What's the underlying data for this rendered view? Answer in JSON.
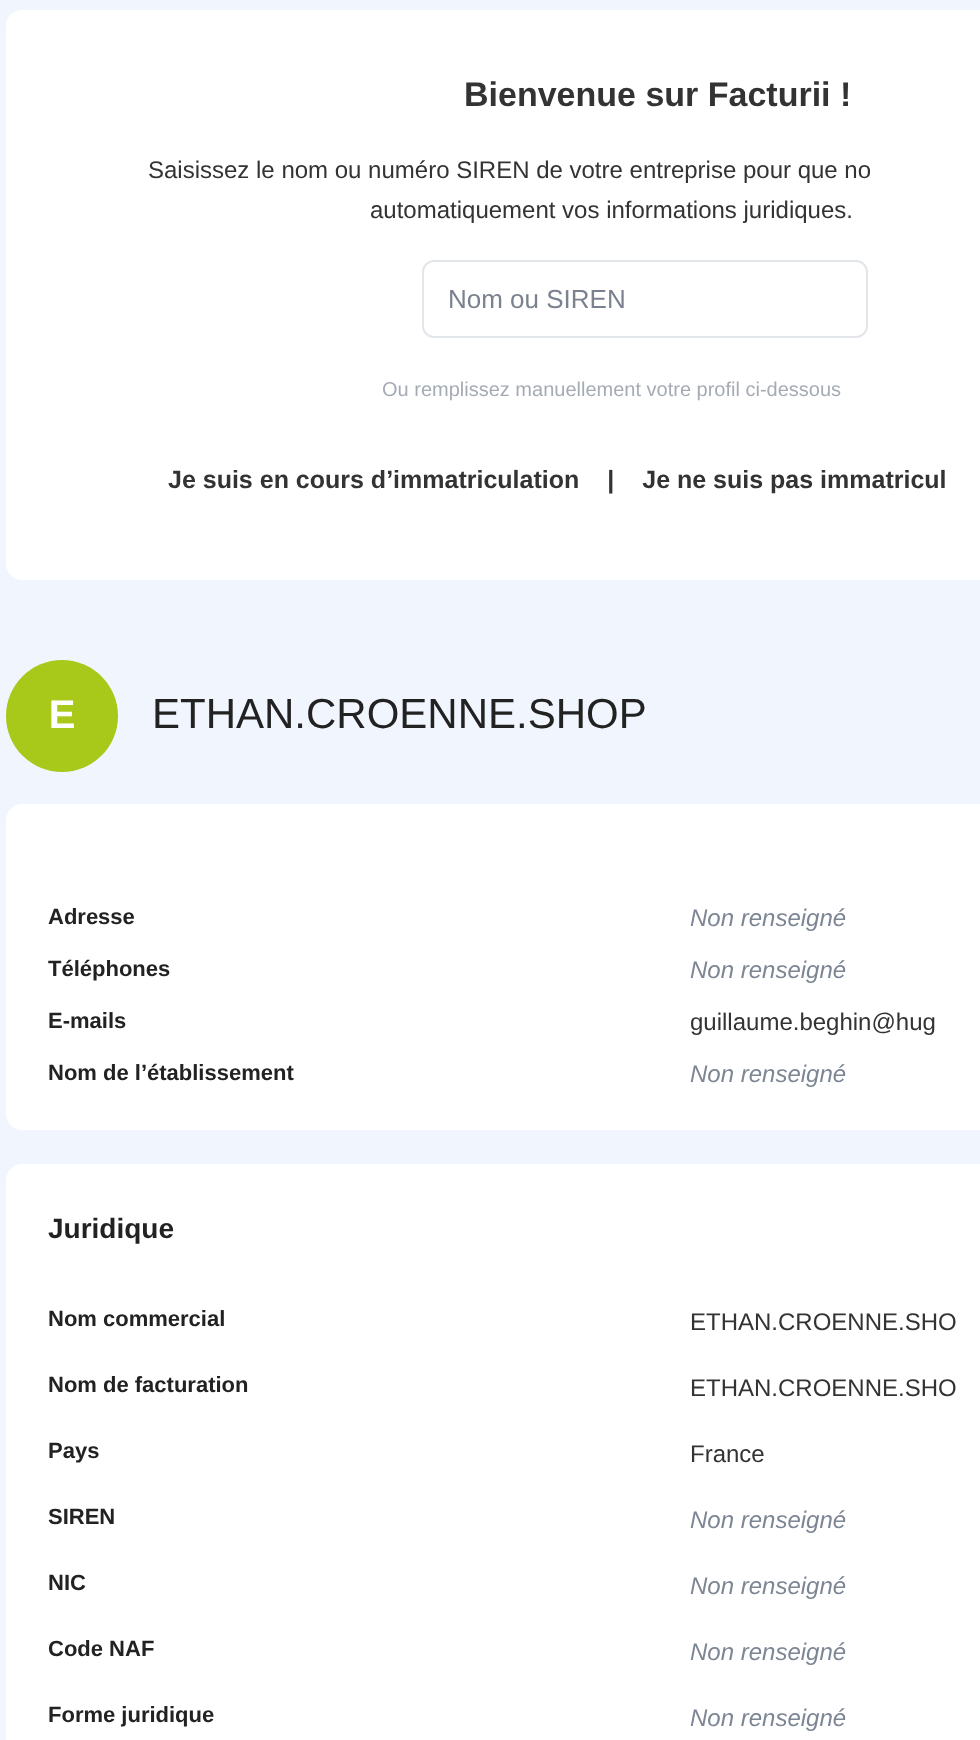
{
  "welcome": {
    "title": "Bienvenue sur Facturii !",
    "intro_lines": [
      "Saisissez le nom ou numéro SIREN de votre entreprise pour que no",
      "automatiquement vos informations juridiques."
    ],
    "search": {
      "placeholder": "Nom ou SIREN"
    },
    "hint": "Ou remplissez manuellement votre profil ci-dessous",
    "links": [
      "Je suis en cours d’immatriculation",
      "Je ne suis pas immatricul"
    ],
    "separator": "|"
  },
  "company": {
    "initial": "E",
    "name": "ETHAN.CROENNE.SHOP"
  },
  "contact": {
    "rows": [
      {
        "label": "Adresse",
        "value": "Non renseigné",
        "empty": true
      },
      {
        "label": "Téléphones",
        "value": "Non renseigné",
        "empty": true
      },
      {
        "label": "E-mails",
        "value": "guillaume.beghin@hug",
        "empty": false
      },
      {
        "label": "Nom de l’établissement",
        "value": "Non renseigné",
        "empty": true
      }
    ]
  },
  "legal": {
    "title": "Juridique",
    "rows": [
      {
        "label": "Nom commercial",
        "value": "ETHAN.CROENNE.SHO",
        "empty": false
      },
      {
        "label": "Nom de facturation",
        "value": "ETHAN.CROENNE.SHO",
        "empty": false
      },
      {
        "label": "Pays",
        "value": "France",
        "empty": false
      },
      {
        "label": "SIREN",
        "value": "Non renseigné",
        "empty": true
      },
      {
        "label": "NIC",
        "value": "Non renseigné",
        "empty": true
      },
      {
        "label": "Code NAF",
        "value": "Non renseigné",
        "empty": true
      },
      {
        "label": "Forme juridique",
        "value": "Non renseigné",
        "empty": true
      }
    ]
  }
}
